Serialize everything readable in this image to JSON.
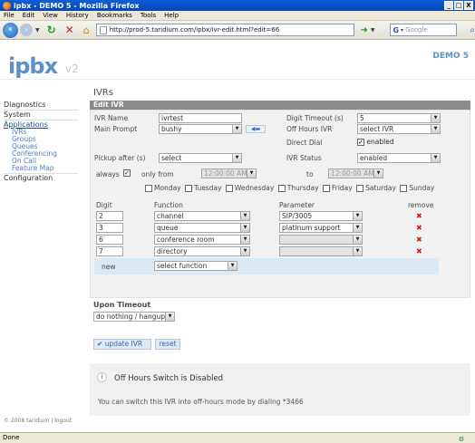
{
  "window": {
    "title": "ipbx - DEMO 5 - Mozilla Firefox",
    "buttons": [
      "_",
      "□",
      "X"
    ]
  },
  "menu": [
    "File",
    "Edit",
    "View",
    "History",
    "Bookmarks",
    "Tools",
    "Help"
  ],
  "nav": {
    "url": "http://prod-5.taridium.com/ipbx/ivr-edit.html?edit=66",
    "search_placeholder": "Google"
  },
  "header": {
    "logo": "ipbx",
    "logo_version": "v2",
    "tenant": "DEMO 5"
  },
  "sidebar": {
    "sections": [
      {
        "label": "Diagnostics",
        "active": false,
        "items": []
      },
      {
        "label": "System",
        "active": false,
        "items": []
      },
      {
        "label": "Applications",
        "active": true,
        "items": [
          "IVRs",
          "Groups",
          "Queues",
          "Conferencing",
          "On Call",
          "Feature Map"
        ]
      },
      {
        "label": "Configuration",
        "active": false,
        "items": []
      }
    ],
    "copyright": "© 2008 taridium | logout"
  },
  "main": {
    "page_title": "IVRs",
    "box_title": "Edit IVR",
    "form": {
      "ivr_name_label": "IVR Name",
      "ivr_name_value": "ivrtest",
      "main_prompt_label": "Main Prompt",
      "main_prompt_value": "bushy",
      "pickup_label": "Pickup after (s)",
      "pickup_value": "select",
      "digit_timeout_label": "Digit Timeout (s)",
      "digit_timeout_value": "5",
      "off_hours_label": "Off Hours IVR",
      "off_hours_value": "select IVR",
      "direct_dial_label": "Direct Dial",
      "direct_dial_value": "enabled",
      "ivr_status_label": "IVR Status",
      "ivr_status_value": "enabled"
    },
    "schedule": {
      "always_label": "always",
      "only_from_label": "only from",
      "from_time": "12:00:00 AM",
      "to_label": "to",
      "to_time": "12:00:00 AM",
      "days": [
        "Monday",
        "Tuesday",
        "Wednesday",
        "Thursday",
        "Friday",
        "Saturday",
        "Sunday"
      ]
    },
    "grid": {
      "headers": {
        "digit": "Digit",
        "function": "Function",
        "parameter": "Parameter",
        "remove": "remove"
      },
      "rows": [
        {
          "digit": "2",
          "function": "channel",
          "parameter": "SIP/3005",
          "param_disabled": false
        },
        {
          "digit": "3",
          "function": "queue",
          "parameter": "platinum support",
          "param_disabled": false
        },
        {
          "digit": "6",
          "function": "conference room",
          "parameter": "",
          "param_disabled": true
        },
        {
          "digit": "7",
          "function": "directory",
          "parameter": "",
          "param_disabled": true
        }
      ],
      "new_label": "new",
      "new_function": "select function"
    },
    "timeout": {
      "title": "Upon Timeout",
      "value": "do nothing / hangup"
    },
    "buttons": {
      "update": "update IVR",
      "reset": "reset"
    },
    "info": {
      "title": "Off Hours Switch is Disabled",
      "text": "You can switch this IVR into off-hours mode by dialing *3466"
    }
  },
  "status": "Done"
}
